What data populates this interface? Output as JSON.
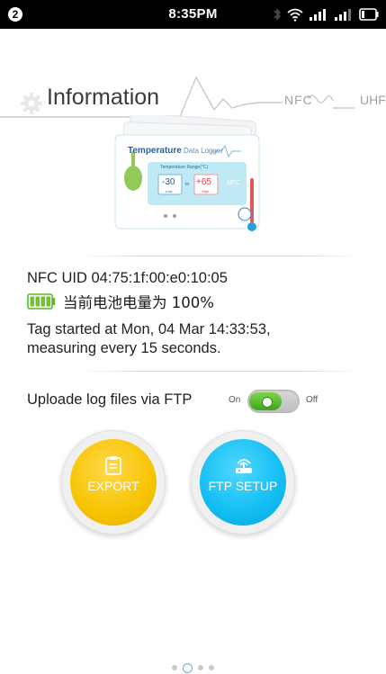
{
  "status_bar": {
    "notification_count": "2",
    "time": "8:35PM"
  },
  "header": {
    "title": "Information",
    "nfc_label": "NFC",
    "uhf_label": "UHF"
  },
  "device_image": {
    "brand": "Temperature",
    "product": "Data Logger",
    "range_label": "Temperature Range(°C)",
    "low_value": "-30",
    "low_label": "Low",
    "to": "to",
    "high_value": "+65",
    "high_label": "High",
    "nfc": "NFC"
  },
  "tag_info": {
    "nfc_uid": "NFC UID 04:75:1f:00:e0:10:05",
    "battery_text": "当前电池电量为 100%",
    "battery_level": 1.0,
    "start_line1": "Tag started at Mon, 04 Mar 14:33:53,",
    "start_line2": "measuring every 15 seconds."
  },
  "ftp_toggle": {
    "label": "Uploade log files via FTP",
    "on_label": "On",
    "off_label": "Off",
    "state": "on"
  },
  "buttons": {
    "export_label": "EXPORT",
    "ftp_setup_label": "FTP SETUP"
  },
  "pager": {
    "count": 4,
    "active_index": 1
  },
  "colors": {
    "export": "#f6c400",
    "ftp_setup": "#12bdf2",
    "toggle_on": "#4cb626",
    "battery": "#6cc62c"
  }
}
